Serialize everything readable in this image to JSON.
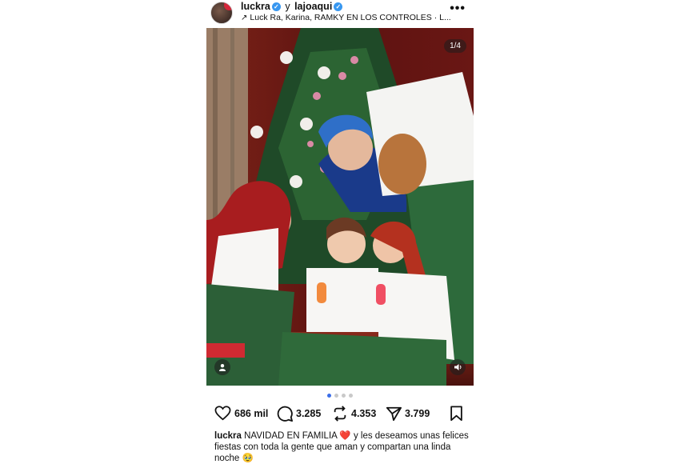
{
  "header": {
    "author1": "luckra",
    "connector": "y",
    "author2": "lajoaqui",
    "collab_line": "Luck Ra, Karina, RAMKY EN LOS CONTROLES · L...",
    "more_icon": "more-horizontal-icon"
  },
  "photo": {
    "counter": "1/4",
    "tagged_icon": "user-tag-icon",
    "audio_icon": "volume-icon"
  },
  "carousel": {
    "total": 4,
    "active": 1
  },
  "actions": {
    "likes": "686 mil",
    "comments": "3.285",
    "reposts": "4.353",
    "shares": "3.799"
  },
  "caption": {
    "username": "luckra",
    "text_part1": "NAVIDAD EN FAMILIA",
    "emoji1": "❤️",
    "text_part2": "y les deseamos unas felices fiestas con toda la gente que aman y compartan una linda noche",
    "emoji2": "🥹"
  },
  "colors": {
    "accent": "#3b6ee8",
    "verified": "#3897f0",
    "heart": "#e0243a"
  }
}
